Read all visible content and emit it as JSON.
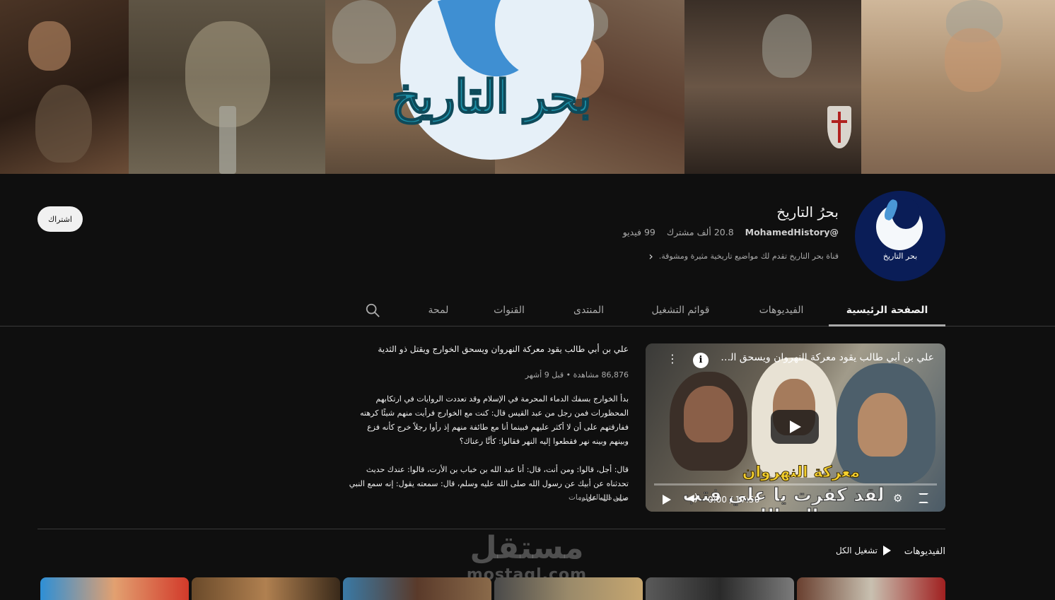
{
  "banner": {
    "title": "بحر التاريخ"
  },
  "channel": {
    "name": "بحرُ التاريخ",
    "avatar_text": "بحر التاريخ",
    "handle": "@MohamedHistory",
    "subscribers": "20.8 ألف مشترك",
    "videos": "99 فيديو",
    "description": "قناة بحر التاريخ تقدم لك مواضيع تاريخية مثيرة ومشوقة."
  },
  "subscribe_label": "اشتراك",
  "tabs": [
    {
      "label": "الصفحة الرئيسية",
      "active": true
    },
    {
      "label": "الفيديوهات"
    },
    {
      "label": "قوائم التشغيل"
    },
    {
      "label": "المنتدى"
    },
    {
      "label": "القنوات"
    },
    {
      "label": "لمحة"
    }
  ],
  "featured": {
    "player_title": "علي بن أبي طالب يقود معركة النهروان ويسحق الخوارج ويقتل ذو الثدية",
    "player_banner": "معركة النهروان",
    "player_subtitle": "لقد كفرت يا علي فتب إلى الله",
    "time": "0:00 / 17:50",
    "title": "علي بن أبي طالب يقود معركة النهروان ويسحق الخوارج ويقتل ذو الثدية",
    "meta": "86,876 مشاهدة • قبل 9 أشهر",
    "desc_p1": "بدأ الخوارج بسفك الدماء المحرمة في الإسلام وقد تعددت الروايات في ارتكابهم المحظورات فمن رجل من عبد القيس قال: كنت مع الخوارج فرأيت منهم شيئًا كرهته ففارقتهم على أن لا أكثر عليهم فبينما أنا مع طائفة منهم إذ رأوا رجلاً خرج كأنه فزع وبينهم وبينه نهر فقطعوا إليه النهر فقالوا: كأنَّا رعناك؟",
    "desc_p2": "قال: أجل، قالوا: ومن أنت، قال: أنا عبد الله بن خباب بن الأرت، قالوا: عندك حديث تحدثناه عن أبيك عن رسول الله صلى الله عليه وسلم، قال: سمعته يقول: إنه سمع النبي صلى الله عل...",
    "more": "مزيد من المعلومات"
  },
  "shelf": {
    "title": "الفيديوهات",
    "play_all": "تشغيل الكل"
  },
  "watermark": {
    "ar": "مستقل",
    "en": "mostaql.com"
  }
}
